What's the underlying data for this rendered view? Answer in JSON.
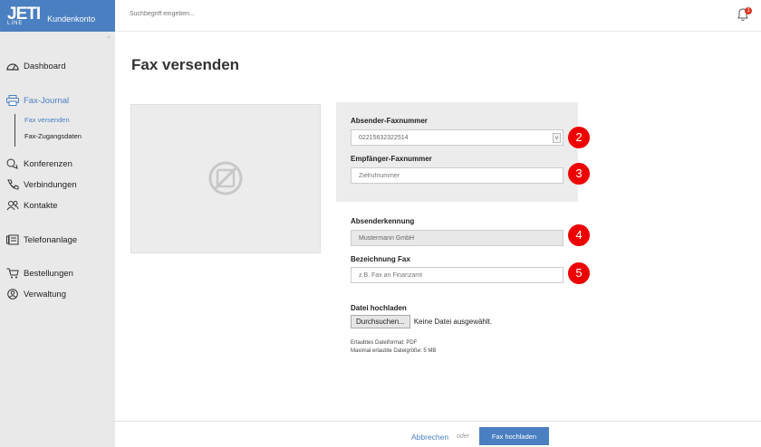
{
  "brand": {
    "logo_main": "JETI",
    "logo_sub": "LINE",
    "title": "Kundenkonto"
  },
  "search": {
    "placeholder": "Suchbegriff eingeben..."
  },
  "notifications": {
    "count": "1"
  },
  "sidebar": {
    "collapse_glyph": "«",
    "items": [
      {
        "label": "Dashboard",
        "icon": "dashboard-icon"
      },
      {
        "label": "Fax-Journal",
        "icon": "printer-icon"
      },
      {
        "label": "Konferenzen",
        "icon": "conference-icon"
      },
      {
        "label": "Verbindungen",
        "icon": "phone-icon"
      },
      {
        "label": "Kontakte",
        "icon": "contacts-icon"
      },
      {
        "label": "Telefonanlage",
        "icon": "pbx-icon"
      },
      {
        "label": "Bestellungen",
        "icon": "cart-icon"
      },
      {
        "label": "Verwaltung",
        "icon": "admin-icon"
      }
    ],
    "subitems": [
      {
        "label": "Fax versenden"
      },
      {
        "label": "Fax-Zugangsdaten"
      }
    ]
  },
  "main": {
    "title": "Fax versenden",
    "sender_fax": {
      "label": "Absender-Faxnummer",
      "value": "02215632322514",
      "badge": "2"
    },
    "recipient_fax": {
      "label": "Empfänger-Faxnummer",
      "placeholder": "Zielrufnummer",
      "badge": "3"
    },
    "sender_id": {
      "label": "Absenderkennung",
      "value": "Mustermann GmbH",
      "badge": "4"
    },
    "fax_name": {
      "label": "Bezeichnung Fax",
      "placeholder": "z.B. Fax an Finanzamt",
      "badge": "5"
    },
    "upload": {
      "label": "Datei hochladen",
      "button": "Durchsuchen...",
      "status": "Keine Datei ausgewählt.",
      "hint_format": "Erlaubtes Dateiformat: PDF",
      "hint_size": "Maximal erlaubte Dateigröße: 5 MB"
    }
  },
  "footer": {
    "cancel": "Abbrechen",
    "or": "oder",
    "submit": "Fax hochladen"
  },
  "colors": {
    "accent": "#4a7fc1",
    "badge": "#e00000",
    "sidebar_bg": "#e9e9e9"
  }
}
